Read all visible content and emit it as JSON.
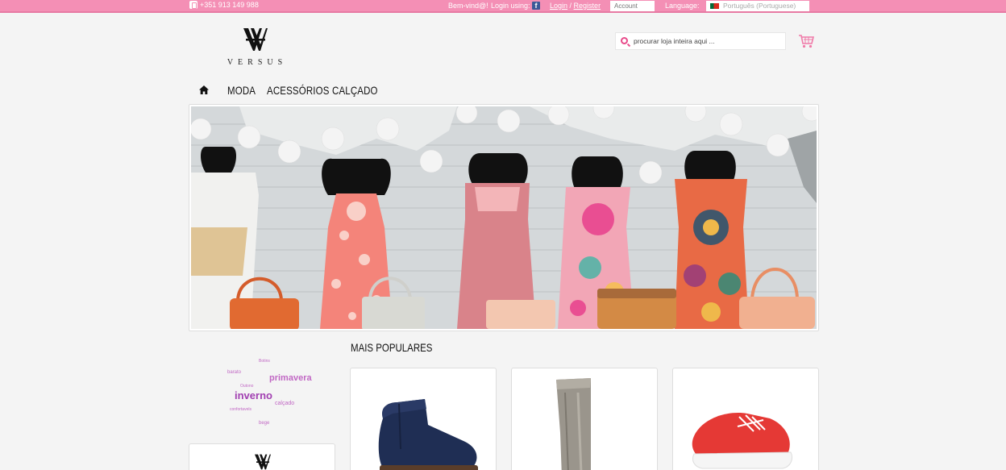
{
  "topbar": {
    "phone": "+351 913 149 988",
    "welcome": "Bem-vind@!",
    "login_using": "Login using:",
    "login": "Login",
    "separator": " / ",
    "register": "Register",
    "account_placeholder": "Account",
    "language_label": "Language:",
    "language_value": "Português (Portuguese)"
  },
  "header": {
    "logo_text": "VERSUS",
    "search_placeholder": "procurar loja inteira aqui ..."
  },
  "nav": {
    "items": [
      {
        "label": "MODA"
      },
      {
        "label": "ACESSÓRIOS"
      },
      {
        "label": "CALÇADO"
      }
    ]
  },
  "tags": [
    {
      "label": "Botins"
    },
    {
      "label": "barato"
    },
    {
      "label": "primavera"
    },
    {
      "label": "Outono"
    },
    {
      "label": "inverno"
    },
    {
      "label": "calçado"
    },
    {
      "label": "confortavels"
    },
    {
      "label": "bege"
    }
  ],
  "popular": {
    "title": "MAIS POPULARES"
  },
  "colors": {
    "topbar": "#f48fb5",
    "accent": "#e84a8a",
    "tag": "#c168c4",
    "background": "#f4f4f4"
  }
}
